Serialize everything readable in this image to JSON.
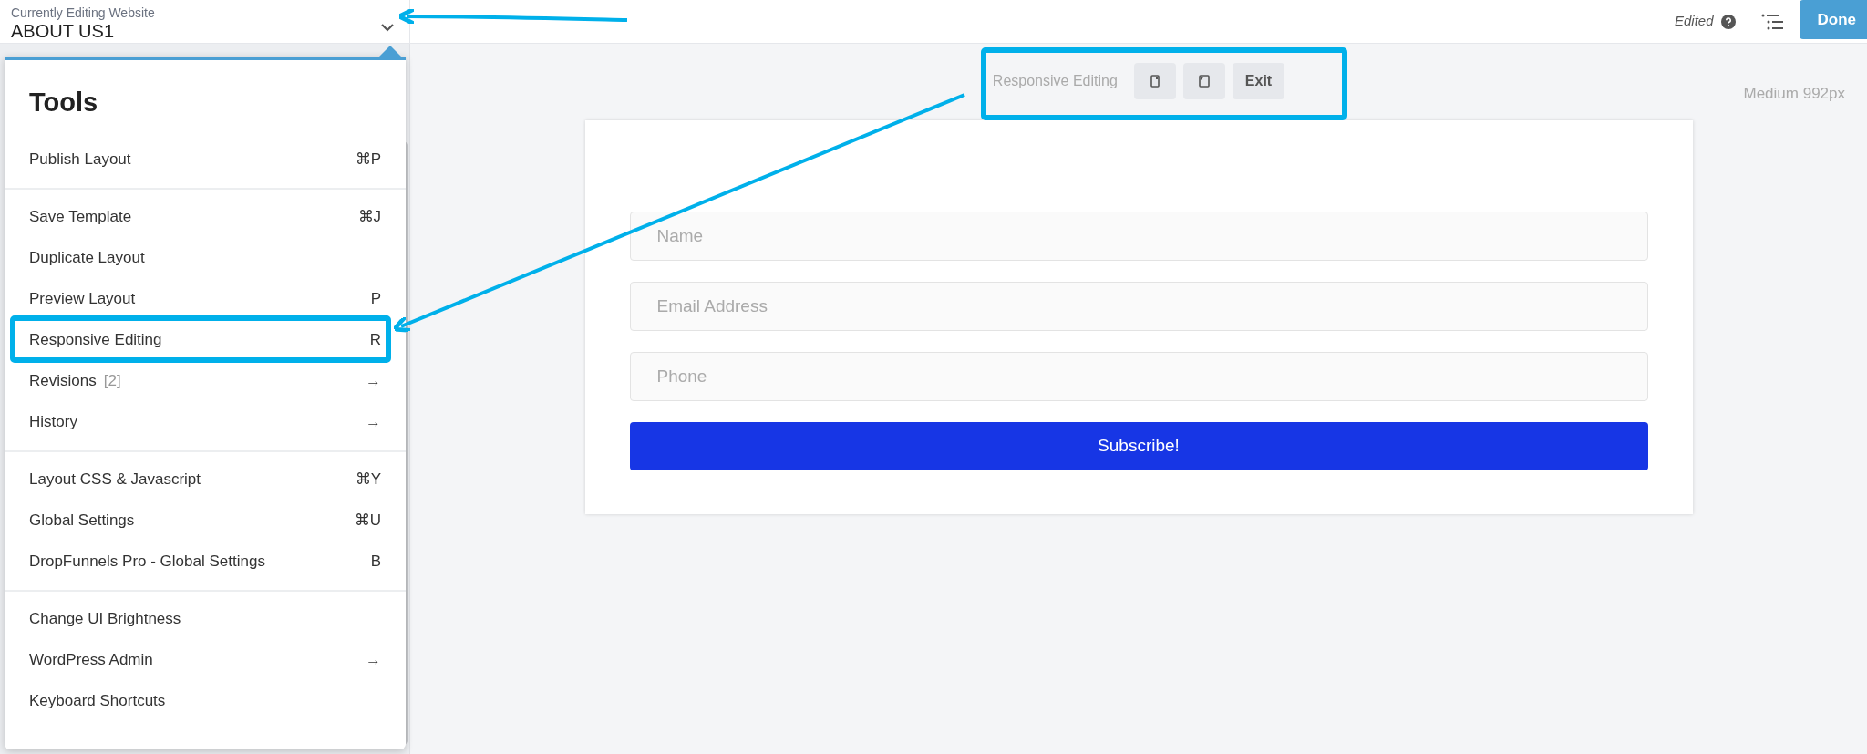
{
  "header": {
    "label": "Currently Editing Website",
    "title": "ABOUT US1"
  },
  "top_bar": {
    "status": "Edited",
    "done_button": "Done"
  },
  "tools_menu": {
    "title": "Tools",
    "groups": [
      [
        {
          "label": "Publish Layout",
          "shortcut": "⌘P"
        }
      ],
      [
        {
          "label": "Save Template",
          "shortcut": "⌘J"
        },
        {
          "label": "Duplicate Layout"
        },
        {
          "label": "Preview Layout",
          "shortcut": "P"
        },
        {
          "label": "Responsive Editing",
          "shortcut": "R"
        },
        {
          "label": "Revisions",
          "count": "[2]",
          "shortcut": "→"
        },
        {
          "label": "History",
          "shortcut": "→"
        }
      ],
      [
        {
          "label": "Layout CSS & Javascript",
          "shortcut": "⌘Y"
        },
        {
          "label": "Global Settings",
          "shortcut": "⌘U"
        },
        {
          "label": "DropFunnels Pro - Global Settings",
          "shortcut": "B"
        }
      ],
      [
        {
          "label": "Change UI Brightness"
        },
        {
          "label": "WordPress Admin",
          "shortcut": "→"
        },
        {
          "label": "Keyboard Shortcuts"
        }
      ]
    ]
  },
  "responsive_toolbar": {
    "label": "Responsive Editing",
    "exit_button": "Exit"
  },
  "breakpoint": "Medium 992px",
  "form": {
    "fields": [
      {
        "placeholder": "Name"
      },
      {
        "placeholder": "Email Address"
      },
      {
        "placeholder": "Phone"
      }
    ],
    "submit": "Subscribe!"
  }
}
